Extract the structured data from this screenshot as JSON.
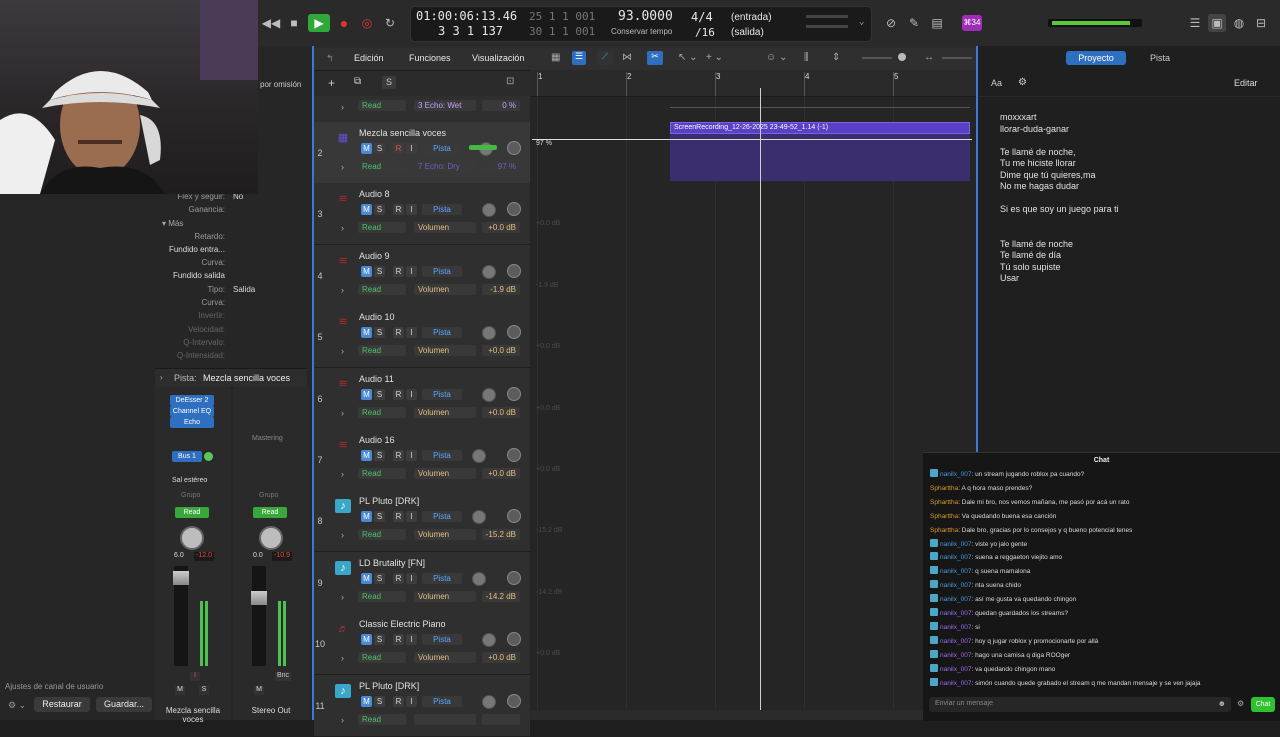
{
  "transport": {
    "time": "01:00:06:13.46",
    "bars_top": "25  1  1  001",
    "bars_main": "3  3  1  137",
    "bars_sub": "30  1  1  001",
    "tempo": "93.0000",
    "tempo_label": "Conservar tempo",
    "signature": "4/4",
    "division": "/16",
    "in_label": "(entrada)",
    "out_label": "(salida)",
    "badge": "⌘34"
  },
  "toolbar": {
    "edit": "Edición",
    "functions": "Funciones",
    "view": "Visualización"
  },
  "track_area": {
    "side_label": "por omisión",
    "s_btn": "S"
  },
  "ruler": [
    "1",
    "2",
    "3",
    "4",
    "5"
  ],
  "region": {
    "name": "ScreenRecording_12-26-2025 23-49-52_1.14 (-1)",
    "volume": "97 %"
  },
  "first_row": {
    "mode": "Read",
    "param": "3 Echo: Wet",
    "value": "0 %"
  },
  "tracks": [
    {
      "num": "2",
      "name": "Mezcla sencilla voces",
      "mode": "Read",
      "param": "7 Echo: Dry",
      "value": "97 %",
      "color": "#6a4bd8",
      "icon": "mixer-icon",
      "ghost": ""
    },
    {
      "num": "3",
      "name": "Audio 8",
      "mode": "Read",
      "param": "Volumen",
      "value": "+0.0 dB",
      "color": "#b02a2a",
      "icon": "waveform-icon",
      "ghost": "+0.0 dB"
    },
    {
      "num": "4",
      "name": "Audio 9",
      "mode": "Read",
      "param": "Volumen",
      "value": "-1.9 dB",
      "color": "#b02a2a",
      "icon": "waveform-icon",
      "ghost": "-1.9 dB"
    },
    {
      "num": "5",
      "name": "Audio 10",
      "mode": "Read",
      "param": "Volumen",
      "value": "+0.0 dB",
      "color": "#b02a2a",
      "icon": "waveform-icon",
      "ghost": "+0.0 dB"
    },
    {
      "num": "6",
      "name": "Audio 11",
      "mode": "Read",
      "param": "Volumen",
      "value": "+0.0 dB",
      "color": "#b02a2a",
      "icon": "waveform-icon",
      "ghost": "+0.0 dB"
    },
    {
      "num": "7",
      "name": "Audio 16",
      "mode": "Read",
      "param": "Volumen",
      "value": "+0.0 dB",
      "color": "#b02a2a",
      "icon": "waveform-icon",
      "ghost": "+0.0 dB"
    },
    {
      "num": "8",
      "name": "PL Pluto [DRK]",
      "mode": "Read",
      "param": "Volumen",
      "value": "-15.2 dB",
      "color": "#3aa6c8",
      "icon": "music-note-icon",
      "ghost": "-15.2 dB"
    },
    {
      "num": "9",
      "name": "LD Brutality [FN]",
      "mode": "Read",
      "param": "Volumen",
      "value": "-14.2 dB",
      "color": "#3aa6c8",
      "icon": "music-note-icon",
      "ghost": "-14.2 dB"
    },
    {
      "num": "10",
      "name": "Classic Electric Piano",
      "mode": "Read",
      "param": "Volumen",
      "value": "+0.0 dB",
      "color": "#b23a3a",
      "icon": "keyboard-icon",
      "ghost": "+0.0 dB"
    },
    {
      "num": "11",
      "name": "PL Pluto [DRK]",
      "mode": "Read",
      "param": "",
      "value": "",
      "color": "#3aa6c8",
      "icon": "music-note-icon",
      "ghost": ""
    }
  ],
  "button_labels": {
    "mute": "M",
    "solo": "S",
    "record": "R",
    "input": "I",
    "pista": "Pista"
  },
  "inspector": {
    "flex_label": "Flex y seguir:",
    "flex_value": "No",
    "gain_label": "Ganancia:",
    "more": "Más",
    "delay": "Retardo:",
    "fade_in": "Fundido entra...",
    "curve1": "Curva:",
    "fade_out": "Fundido salida",
    "type_label": "Tipo:",
    "type_value": "Salida",
    "curve2": "Curva:",
    "invert": "Invertir:",
    "velocity": "Velocidad:",
    "q_interval": "Q-Intervalo:",
    "q_intensity": "Q-Intensidad:",
    "pista_label": "Pista:",
    "pista_value": "Mezcla sencilla voces",
    "plugins": [
      "DeEsser 2",
      "Channel EQ",
      "Echo"
    ],
    "mastering": "Mastering",
    "bus": "Bus 1",
    "stereo_out": "Sal estéreo",
    "group": "Grupo",
    "read": "Read",
    "ch1_vals": [
      "6.0",
      "-12.0"
    ],
    "ch2_vals": [
      "0.0",
      "-10.9"
    ],
    "bnc": "Bnc",
    "ch1_name": "Mezcla sencilla voces",
    "ch2_name": "Stereo Out",
    "ch_settings": "Ajustes de canal de usuario",
    "restore": "Restaurar",
    "save": "Guardar..."
  },
  "right_panel": {
    "tab_project": "Proyecto",
    "tab_track": "Pista",
    "aa": "Aa",
    "edit": "Editar",
    "lyrics": [
      "moxxxart",
      "llorar-duda-ganar",
      "",
      "Te llamé de noche,",
      "Tu me hiciste llorar",
      "Dime que tú quieres,ma",
      "No me hagas dudar",
      "",
      "Si es que soy un juego para ti",
      "",
      "",
      "Te llamé de noche",
      "Te llamé de día",
      "Tú solo supiste",
      "Usar"
    ]
  },
  "chat": {
    "title": "Chat",
    "placeholder": "Enviar un mensaje",
    "send": "Chat",
    "messages": [
      {
        "user": "nanilx_007",
        "text": ": un stream jugando roblox pa cuando?",
        "style": "u1"
      },
      {
        "user": "Spharttha",
        "text": ": A q hora maso prendes?",
        "style": "u2"
      },
      {
        "user": "Spharttha",
        "text": ": Dale mi bro, nos vemos mañana, me pasó por acá un rato",
        "style": "u2"
      },
      {
        "user": "Spharttha",
        "text": ": Va quedando buena esa canción",
        "style": "u2"
      },
      {
        "user": "Spharttha",
        "text": ": Dale bro, gracias por lo consejos y q bueno potencial tenes",
        "style": "u2"
      },
      {
        "user": "nanilx_007",
        "text": ": viste yo jalo gente",
        "style": "u1"
      },
      {
        "user": "nanilx_007",
        "text": ": suena a reggaeton viejito amo",
        "style": "u1"
      },
      {
        "user": "nanilx_007",
        "text": ": q suena mamalona",
        "style": "u1"
      },
      {
        "user": "nanilx_007",
        "text": ": nta suena chido",
        "style": "u1"
      },
      {
        "user": "nanilx_007",
        "text": ": así me gusta va quedando chingon",
        "style": "u1"
      },
      {
        "user": "nanilx_007",
        "text": ": quedan guardados los streams?",
        "style": "u3"
      },
      {
        "user": "nanilx_007",
        "text": ": si",
        "style": "u3"
      },
      {
        "user": "nanilx_007",
        "text": ": hoy q jugar roblox y promocionarte por allá",
        "style": "u3"
      },
      {
        "user": "nanilx_007",
        "text": ": hago una camisa q diga ROOger",
        "style": "u3"
      },
      {
        "user": "nanilx_007",
        "text": ": va quedando chingon mano",
        "style": "u3"
      },
      {
        "user": "nanilx_007",
        "text": ": simón cuando quede grabado el stream q me mandan mensaje y se ven jajaja",
        "style": "u3"
      }
    ]
  }
}
